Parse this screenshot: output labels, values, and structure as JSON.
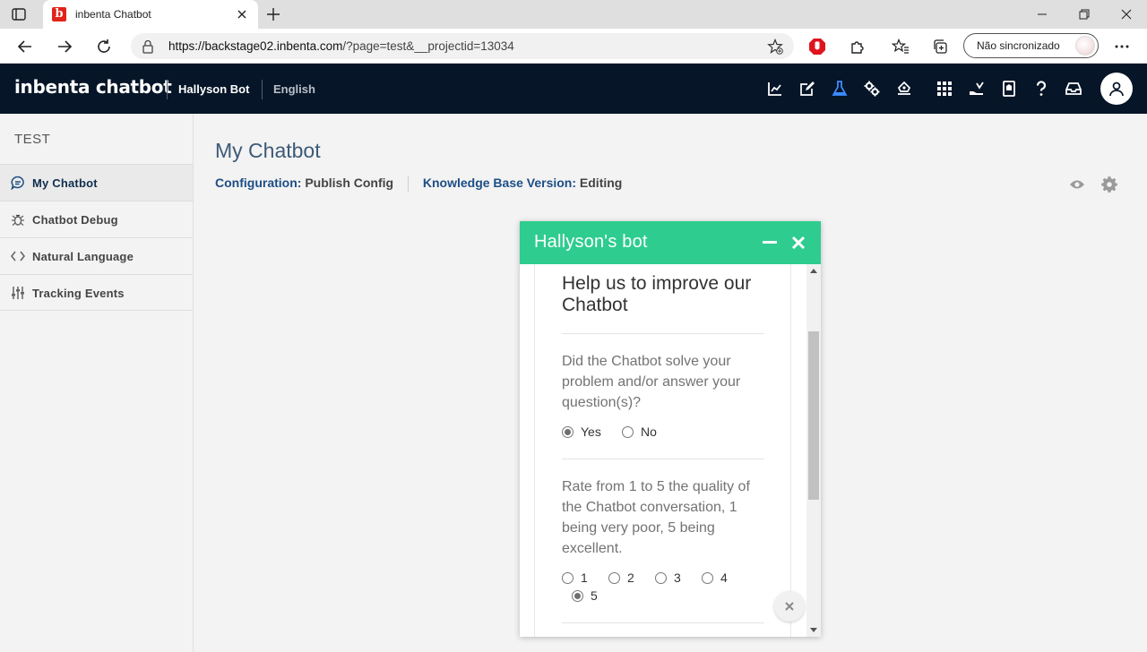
{
  "browser": {
    "tab_title": "inbenta Chatbot",
    "favicon_letter": "b",
    "url_host": "https://backstage02.inbenta.com",
    "url_path": "/?page=test&__projectid=13034",
    "sync_label": "Não sincronizado"
  },
  "header": {
    "brand": "inbenta chatbot",
    "bot_name": "Hallyson Bot",
    "language": "English",
    "icons": [
      "chart-icon",
      "edit-icon",
      "flask-icon",
      "settings-icon",
      "deploy-icon",
      "apps-icon",
      "hand-icon",
      "book-icon",
      "help-icon",
      "inbox-icon",
      "user-icon"
    ],
    "active_icon_color": "#3b8bff"
  },
  "sidebar": {
    "project": "TEST",
    "items": [
      {
        "label": "My Chatbot",
        "icon": "chat-icon",
        "active": true
      },
      {
        "label": "Chatbot Debug",
        "icon": "bug-icon",
        "active": false
      },
      {
        "label": "Natural Language",
        "icon": "code-icon",
        "active": false
      },
      {
        "label": "Tracking Events",
        "icon": "sliders-icon",
        "active": false
      }
    ]
  },
  "main": {
    "title": "My Chatbot",
    "config_key": "Configuration:",
    "config_value": "Publish Config",
    "kb_key": "Knowledge Base Version:",
    "kb_value": "Editing"
  },
  "widget": {
    "title": "Hallyson's bot",
    "header_color": "#2ecc8f",
    "survey_title": "Help us to improve our Chatbot",
    "q1": "Did the Chatbot solve your problem and/or answer your question(s)?",
    "q1_options": [
      {
        "label": "Yes",
        "checked": true
      },
      {
        "label": "No",
        "checked": false
      }
    ],
    "q2": "Rate from 1 to 5 the quality of the Chatbot conversation, 1 being very poor, 5 being excellent.",
    "q2_options": [
      {
        "label": "1",
        "checked": false
      },
      {
        "label": "2",
        "checked": false
      },
      {
        "label": "3",
        "checked": false
      },
      {
        "label": "4",
        "checked": false
      },
      {
        "label": "5",
        "checked": true
      }
    ]
  }
}
